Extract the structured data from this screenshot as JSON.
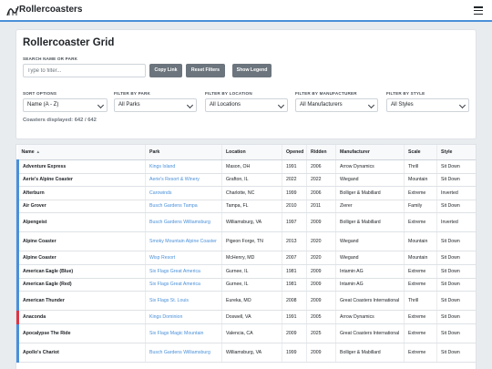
{
  "header": {
    "brand": "Rollercoasters",
    "logo_icon": "rollercoaster-logo-icon",
    "menu_icon": "hamburger-menu-icon",
    "accent_color": "#4a90d9"
  },
  "controls": {
    "title": "Rollercoaster Grid",
    "search_label": "SEARCH NAME OR PARK",
    "search_placeholder": "Type to filter...",
    "search_value": "",
    "copy_link": "Copy Link",
    "reset_filters": "Reset Filters",
    "show_legend": "Show Legend",
    "filters": [
      {
        "label": "SORT OPTIONS",
        "value": "Name (A - Z)"
      },
      {
        "label": "FILTER BY PARK",
        "value": "All Parks"
      },
      {
        "label": "FILTER BY LOCATION",
        "value": "All Locations"
      },
      {
        "label": "FILTER BY MANUFACTURER",
        "value": "All Manufacturers"
      },
      {
        "label": "FILTER BY STYLE",
        "value": "All Styles"
      }
    ],
    "count_text": "Coasters displayed: 642 / 642"
  },
  "table": {
    "sort_arrow": "▲",
    "headers": [
      "Name",
      "Park",
      "Location",
      "Opened",
      "Ridden",
      "Manufacturer",
      "Scale",
      "Style"
    ],
    "rows": [
      {
        "name": "Adventure Express",
        "park": "Kings Island",
        "location": "Mason, OH",
        "opened": "1991",
        "ridden": "2006",
        "manufacturer": "Arrow Dynamics",
        "scale": "Thrill",
        "style": "Sit Down"
      },
      {
        "name": "Aerie's Alpine Coaster",
        "park": "Aerie's Resort & Winery",
        "location": "Grafton, IL",
        "opened": "2022",
        "ridden": "2022",
        "manufacturer": "Wiegand",
        "scale": "Mountain",
        "style": "Sit Down"
      },
      {
        "name": "Afterburn",
        "park": "Carowinds",
        "location": "Charlotte, NC",
        "opened": "1999",
        "ridden": "2006",
        "manufacturer": "Bolliger & Mabillard",
        "scale": "Extreme",
        "style": "Inverted"
      },
      {
        "name": "Air Grover",
        "park": "Busch Gardens Tampa",
        "location": "Tampa, FL",
        "opened": "2010",
        "ridden": "2011",
        "manufacturer": "Zierer",
        "scale": "Family",
        "style": "Sit Down"
      },
      {
        "name": "Alpengeist",
        "park": "Busch Gardens Williamsburg",
        "location": "Williamsburg, VA",
        "opened": "1997",
        "ridden": "2009",
        "manufacturer": "Bolliger & Mabillard",
        "scale": "Extreme",
        "style": "Inverted"
      },
      {
        "name": "Alpine Coaster",
        "park": "Smoky Mountain Alpine Coaster",
        "location": "Pigeon Forge, TN",
        "opened": "2013",
        "ridden": "2020",
        "manufacturer": "Wiegand",
        "scale": "Mountain",
        "style": "Sit Down"
      },
      {
        "name": "Alpine Coaster",
        "park": "Wisp Resort",
        "location": "McHenry, MD",
        "opened": "2007",
        "ridden": "2020",
        "manufacturer": "Wiegand",
        "scale": "Mountain",
        "style": "Sit Down"
      },
      {
        "name": "American Eagle (Blue)",
        "park": "Six Flags Great America",
        "location": "Gurnee, IL",
        "opened": "1981",
        "ridden": "2009",
        "manufacturer": "Intamin AG",
        "scale": "Extreme",
        "style": "Sit Down"
      },
      {
        "name": "American Eagle (Red)",
        "park": "Six Flags Great America",
        "location": "Gurnee, IL",
        "opened": "1981",
        "ridden": "2009",
        "manufacturer": "Intamin AG",
        "scale": "Extreme",
        "style": "Sit Down"
      },
      {
        "name": "American Thunder",
        "park": "Six Flags St. Louis",
        "location": "Eureka, MO",
        "opened": "2008",
        "ridden": "2009",
        "manufacturer": "Great Coasters International",
        "scale": "Thrill",
        "style": "Sit Down"
      },
      {
        "name": "Anaconda",
        "park": "Kings Dominion",
        "location": "Doswell, VA",
        "opened": "1991",
        "ridden": "2005",
        "manufacturer": "Arrow Dynamics",
        "scale": "Extreme",
        "style": "Sit Down"
      },
      {
        "name": "Apocalypse The Ride",
        "park": "Six Flags Magic Mountain",
        "location": "Valencia, CA",
        "opened": "2009",
        "ridden": "2025",
        "manufacturer": "Great Coasters International",
        "scale": "Extreme",
        "style": "Sit Down"
      },
      {
        "name": "Apollo's Chariot",
        "park": "Busch Gardens Williamsburg",
        "location": "Williamsburg, VA",
        "opened": "1999",
        "ridden": "2009",
        "manufacturer": "Bolliger & Mabillard",
        "scale": "Extreme",
        "style": "Sit Down"
      }
    ]
  }
}
